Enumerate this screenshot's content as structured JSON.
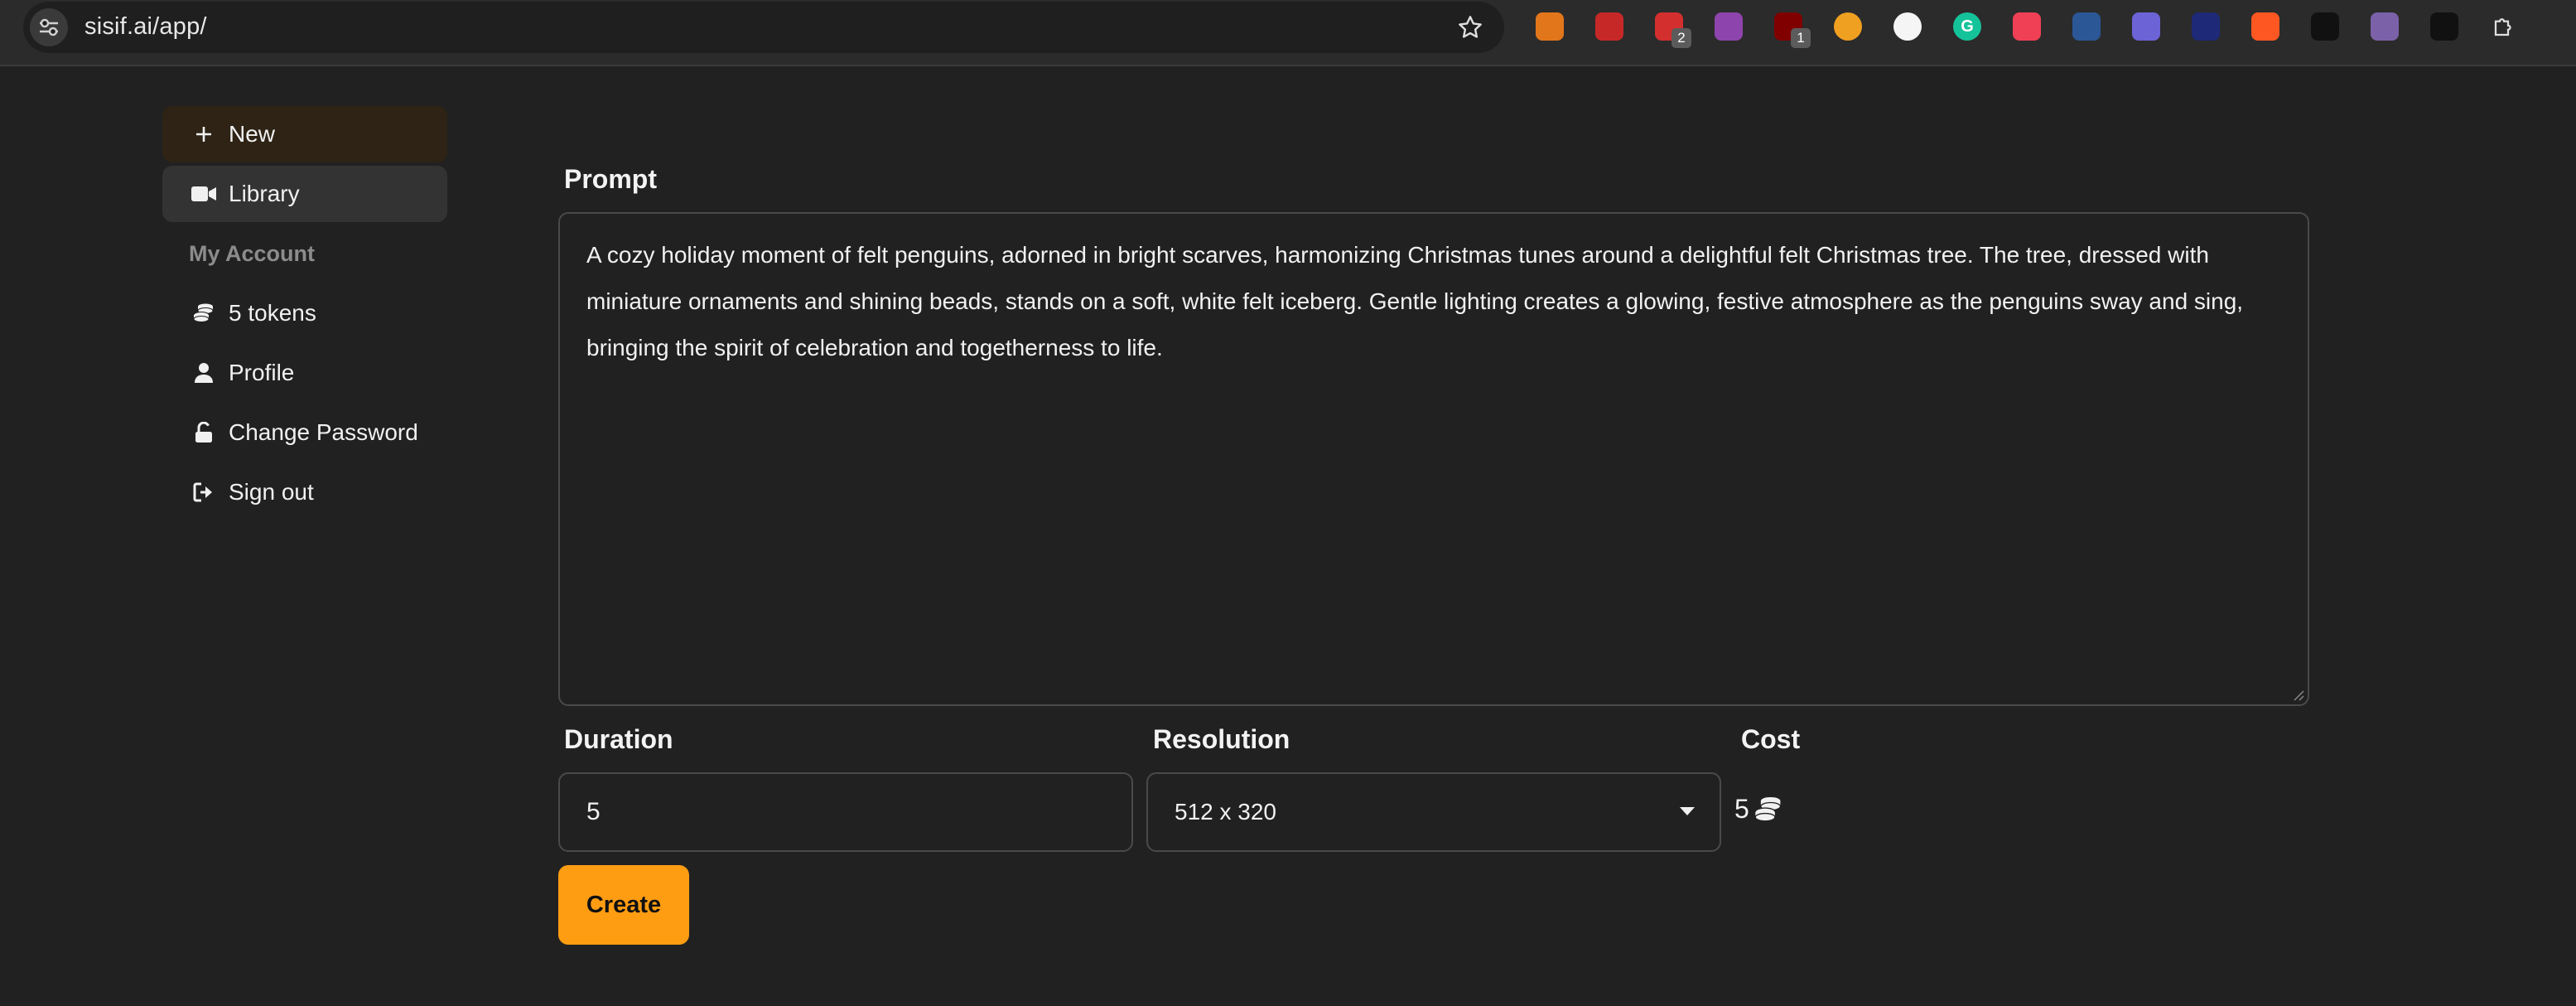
{
  "browser": {
    "url": "sisif.ai/app/",
    "extensions": [
      {
        "name": "metamask-icon",
        "color": "#e2761b",
        "glyph": "",
        "badge": ""
      },
      {
        "name": "medical-cross-icon",
        "color": "#c62828",
        "glyph": "",
        "badge": ""
      },
      {
        "name": "red-calendar-icon",
        "color": "#d32f2f",
        "glyph": "",
        "badge": "2"
      },
      {
        "name": "color-wheel-icon",
        "color": "#8e44ad",
        "glyph": "",
        "badge": ""
      },
      {
        "name": "ublock-icon",
        "color": "#800000",
        "glyph": "",
        "badge": "1"
      },
      {
        "name": "orange-face-icon",
        "color": "#f0a020",
        "glyph": "",
        "badge": ""
      },
      {
        "name": "white-circle-icon",
        "color": "#f5f5f5",
        "glyph": "",
        "badge": ""
      },
      {
        "name": "grammarly-icon",
        "color": "#15c39a",
        "glyph": "G",
        "badge": ""
      },
      {
        "name": "pocket-icon",
        "color": "#ef4056",
        "glyph": "",
        "badge": ""
      },
      {
        "name": "bar-chart-icon",
        "color": "#2b5797",
        "glyph": "",
        "badge": ""
      },
      {
        "name": "ghost-icon",
        "color": "#6b63d6",
        "glyph": "",
        "badge": ""
      },
      {
        "name": "diamond-icon",
        "color": "#1e2a78",
        "glyph": "",
        "badge": ""
      },
      {
        "name": "flame-icon",
        "color": "#ff5722",
        "glyph": "",
        "badge": ""
      },
      {
        "name": "scissors-icon",
        "color": "#111111",
        "glyph": "",
        "badge": ""
      },
      {
        "name": "cat-icon",
        "color": "#7b61a8",
        "glyph": "",
        "badge": ""
      },
      {
        "name": "shield-icon",
        "color": "#111111",
        "glyph": "",
        "badge": ""
      },
      {
        "name": "puzzle-icon",
        "color": "#2b2b2b",
        "glyph": "",
        "badge": ""
      }
    ]
  },
  "sidebar": {
    "new_label": "New",
    "library_label": "Library",
    "account_heading": "My Account",
    "tokens_label": "5 tokens",
    "profile_label": "Profile",
    "change_password_label": "Change Password",
    "sign_out_label": "Sign out"
  },
  "form": {
    "prompt_label": "Prompt",
    "prompt_value": "A cozy holiday moment of felt penguins, adorned in bright scarves, harmonizing Christmas tunes around a delightful felt Christmas tree. The tree, dressed with miniature ornaments and shining beads, stands on a soft, white felt iceberg. Gentle lighting creates a glowing, festive atmosphere as the penguins sway and sing, bringing the spirit of celebration and togetherness to life.",
    "duration_label": "Duration",
    "duration_value": "5",
    "resolution_label": "Resolution",
    "resolution_value": "512 x 320",
    "cost_label": "Cost",
    "cost_value": "5",
    "create_label": "Create"
  },
  "colors": {
    "accent": "#ff9d12",
    "background": "#212121"
  }
}
